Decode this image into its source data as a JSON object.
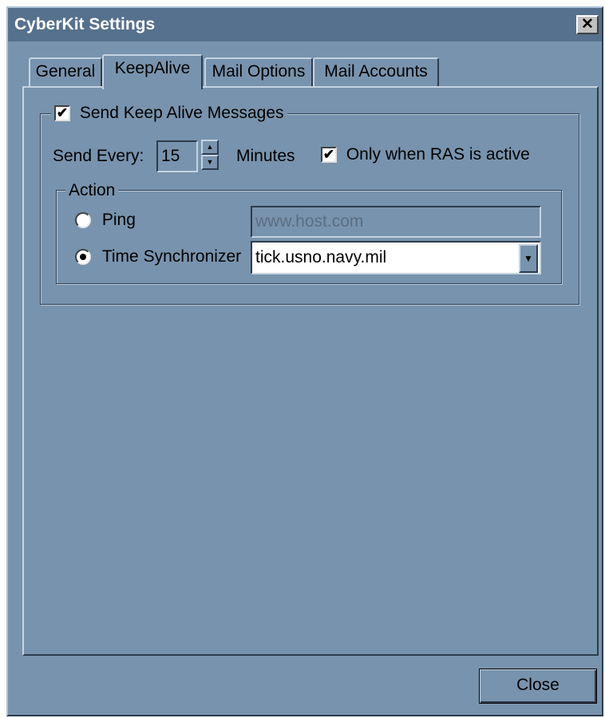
{
  "window": {
    "title": "CyberKit Settings",
    "close_glyph": "✕"
  },
  "tabs": [
    {
      "label": "General",
      "active": false
    },
    {
      "label": "KeepAlive",
      "active": true
    },
    {
      "label": "Mail Options",
      "active": false
    },
    {
      "label": "Mail Accounts",
      "active": false
    }
  ],
  "keepalive": {
    "send_keepalive_label": "Send Keep Alive Messages",
    "send_keepalive_checked": true,
    "send_every_label": "Send Every:",
    "send_every_value": "15",
    "minutes_label": "Minutes",
    "ras_only_label": "Only when RAS is active",
    "ras_only_checked": true
  },
  "action": {
    "legend": "Action",
    "ping_label": "Ping",
    "ping_selected": false,
    "ping_host_value": "www.host.com",
    "time_sync_label": "Time Synchronizer",
    "time_sync_selected": true,
    "time_server_value": "tick.usno.navy.mil"
  },
  "buttons": {
    "close_label": "Close"
  },
  "colors": {
    "dialog_bg": "#7893ad",
    "title_bar": "#56718d"
  }
}
